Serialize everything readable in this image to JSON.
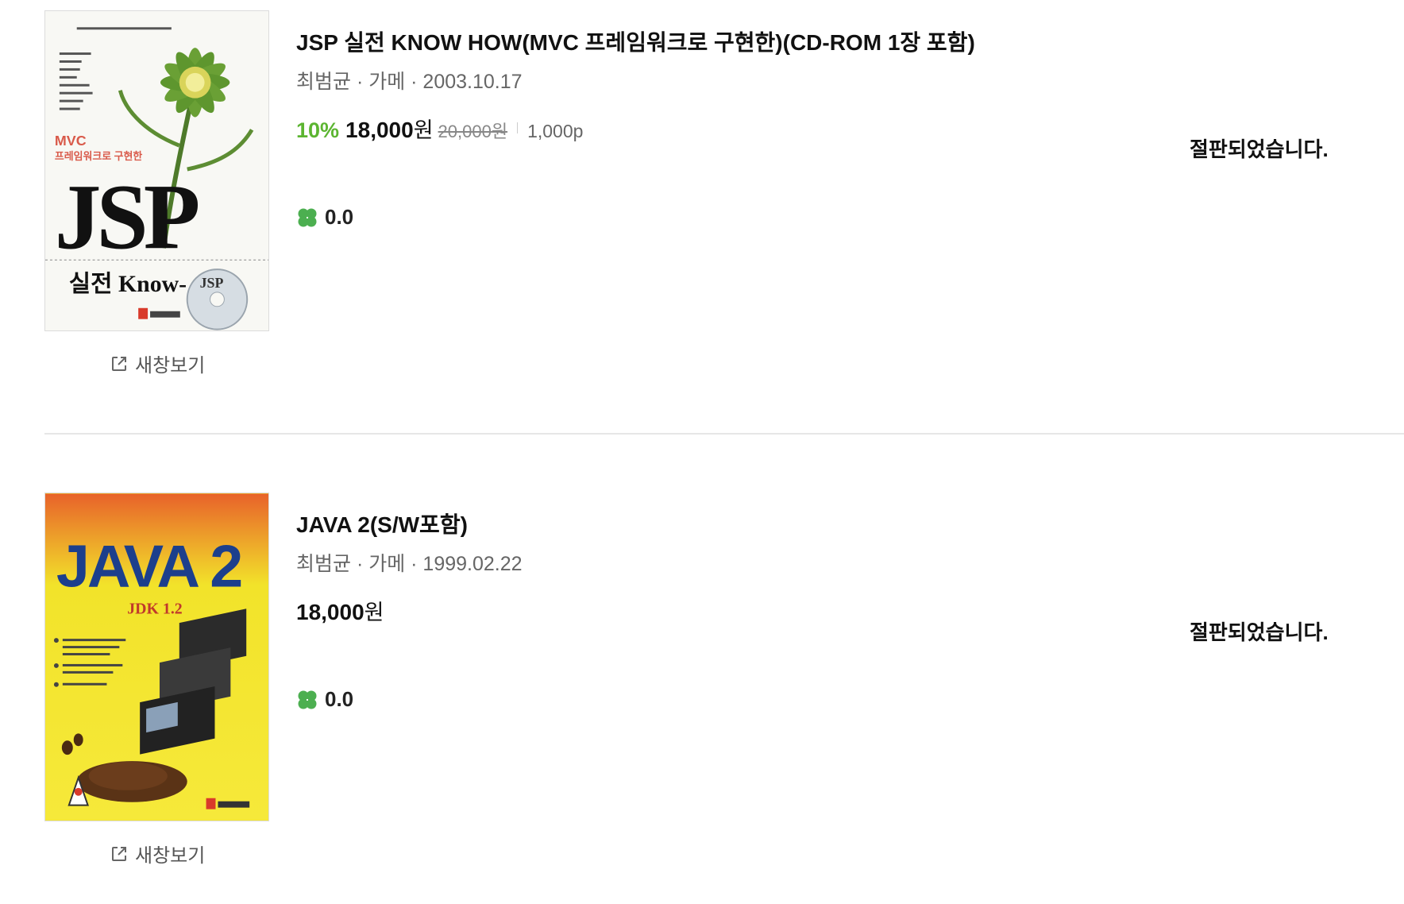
{
  "books": [
    {
      "title": "JSP 실전 KNOW HOW(MVC 프레임워크로 구현한)(CD-ROM 1장 포함)",
      "meta": "최범균 · 가메 · 2003.10.17",
      "discount": "10%",
      "price": "18,000",
      "currency": "원",
      "original_price": "20,000원",
      "points": "1,000p",
      "rating": "0.0",
      "status": "절판되었습니다.",
      "new_window": "새창보기",
      "cover_icon": "book-cover-jsp",
      "cover": {
        "badge": "MVC",
        "subtitle": "프레임워크로 구현한",
        "big": "JSP",
        "bottom": "실전 Know-",
        "cd": "JSP"
      }
    },
    {
      "title": "JAVA 2(S/W포함)",
      "meta": "최범균 · 가메 · 1999.02.22",
      "price": "18,000",
      "currency": "원",
      "rating": "0.0",
      "status": "절판되었습니다.",
      "new_window": "새창보기",
      "cover_icon": "book-cover-java2",
      "cover": {
        "big": "JAVA 2",
        "sub": "JDK 1.2"
      }
    }
  ],
  "colors": {
    "discount": "#5cb531",
    "clover": "#4caf50",
    "divider": "#e6e6e6"
  },
  "icons": {
    "new_window": "external-link-icon",
    "rating": "clover-icon"
  }
}
